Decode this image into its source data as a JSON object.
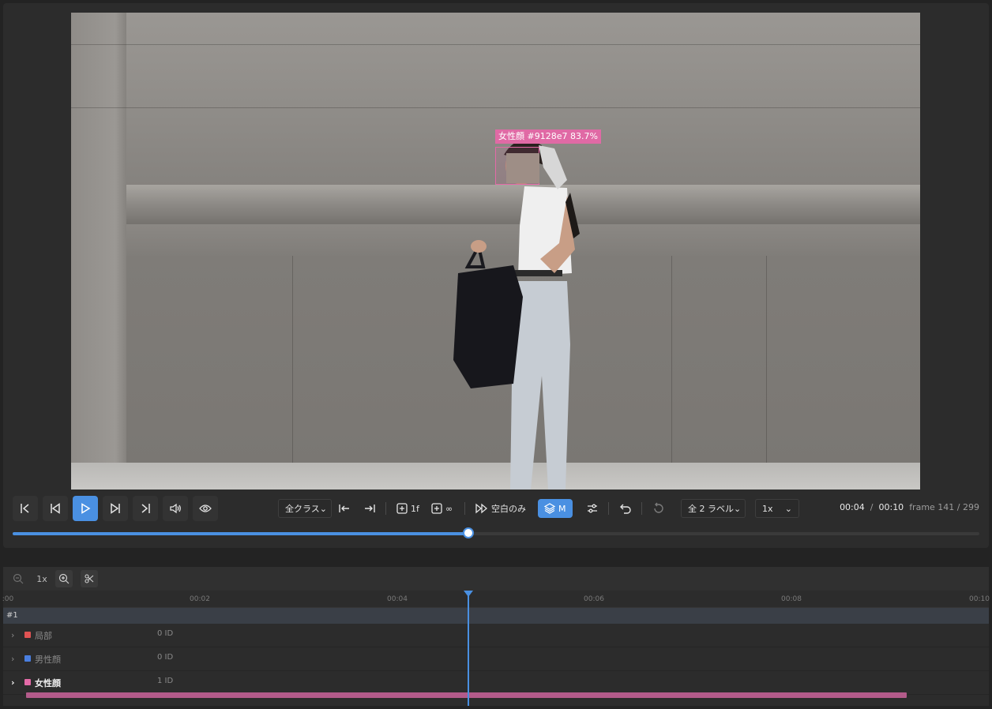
{
  "video": {
    "detection": {
      "label": "女性顔 #9128e7 83.7%",
      "color": "#e36aa7"
    }
  },
  "controls": {
    "class_filter": "全クラス",
    "step_one": "1f",
    "step_inf": "∞",
    "blank_only": "空白のみ",
    "layer_mode": "M",
    "labels_filter": "全 2 ラベル",
    "speed": "1x",
    "time_current": "00:04",
    "time_sep": "/",
    "time_total": "00:10",
    "frame_info": "frame 141 / 299"
  },
  "seek": {
    "progress": 0.471
  },
  "timeline": {
    "zoom_level": "1x",
    "ruler_ticks": [
      ":00",
      "00:02",
      "00:04",
      "00:06",
      "00:08",
      "00:10"
    ],
    "group": "#1",
    "labels": [
      {
        "name": "局部",
        "count": "0 ID",
        "color": "#e05353"
      },
      {
        "name": "男性顔",
        "count": "0 ID",
        "color": "#4a7fe0"
      },
      {
        "name": "女性顔",
        "count": "1 ID",
        "color": "#e36aa7"
      }
    ],
    "accent": "#4a90e2"
  }
}
